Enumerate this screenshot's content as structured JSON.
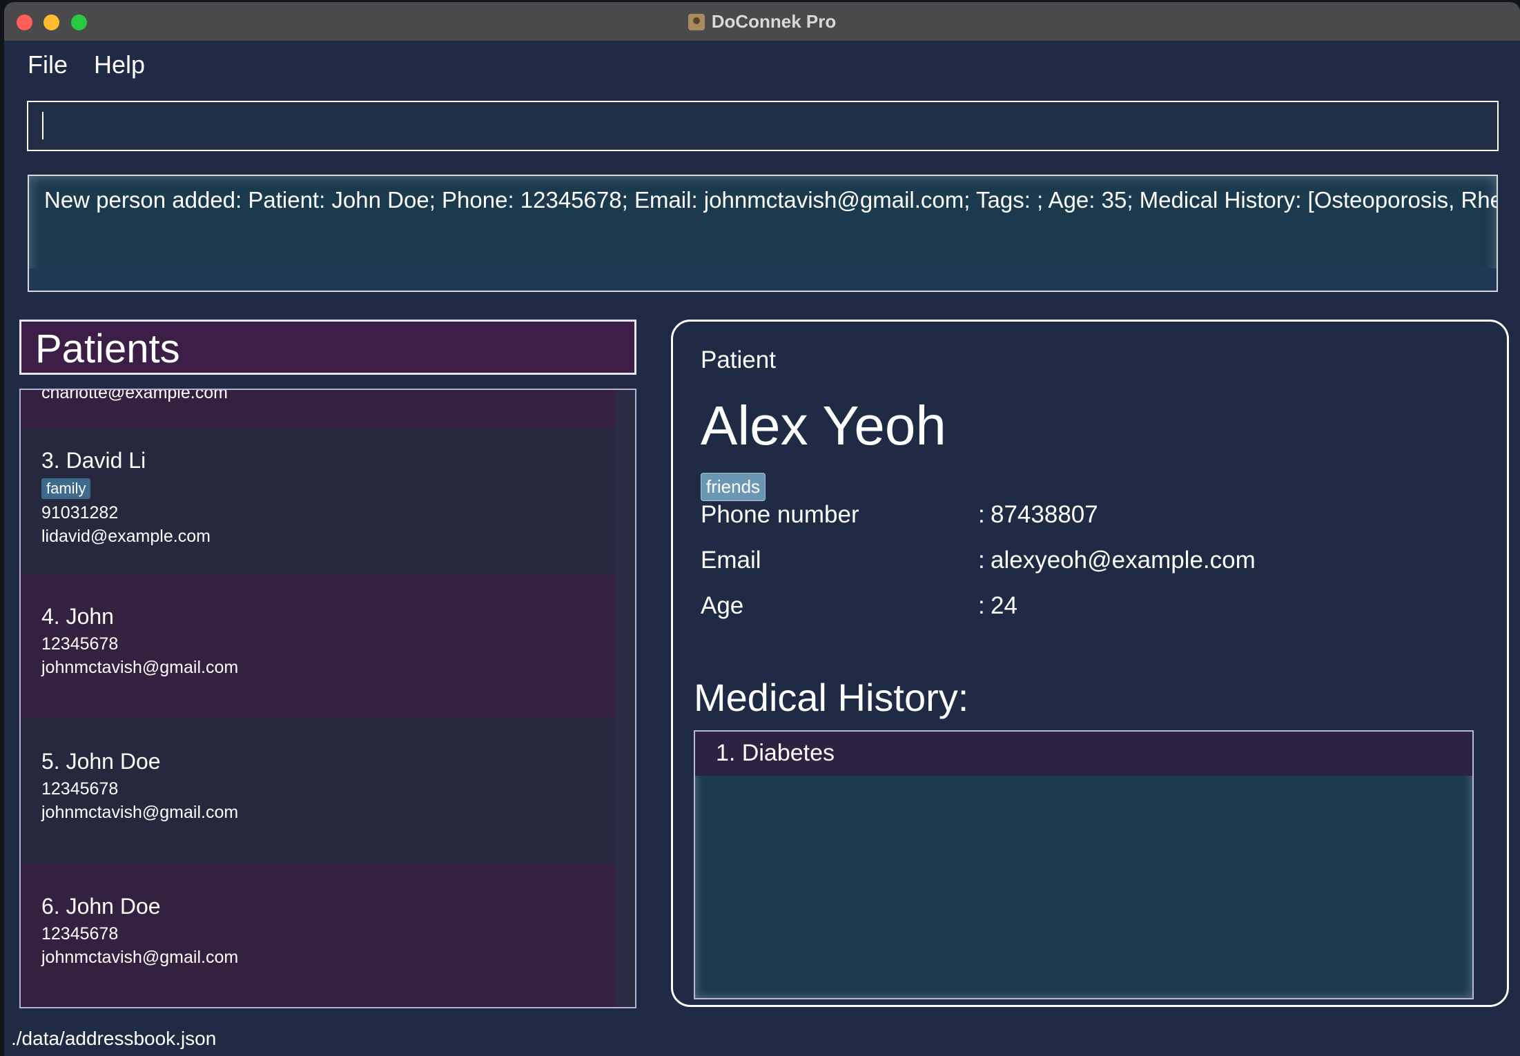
{
  "window": {
    "title": "DoConnek Pro"
  },
  "menu": [
    "File",
    "Help"
  ],
  "command": {
    "value": ""
  },
  "result": {
    "message": "New person added: Patient: John  Doe; Phone: 12345678; Email: johnmctavish@gmail.com; Tags: ; Age: 35; Medical History: [Osteoporosis, Rheu"
  },
  "patients": {
    "header": "Patients",
    "partial_email": "charlotte@example.com",
    "items": [
      {
        "name": "3.  David Li",
        "tag": "family",
        "phone": "91031282",
        "email": "lidavid@example.com"
      },
      {
        "name": "4.  John",
        "phone": "12345678",
        "email": "johnmctavish@gmail.com"
      },
      {
        "name": "5.  John Doe",
        "phone": "12345678",
        "email": "johnmctavish@gmail.com"
      },
      {
        "name": "6.  John  Doe",
        "phone": "12345678",
        "email": "johnmctavish@gmail.com"
      }
    ]
  },
  "detail": {
    "kind": "Patient",
    "name": "Alex Yeoh",
    "tag": "friends",
    "fields": [
      {
        "label": "Phone number",
        "value": "87438807"
      },
      {
        "label": "Email",
        "value": "alexyeoh@example.com"
      },
      {
        "label": "Age",
        "value": "24"
      }
    ],
    "medical_history_heading": "Medical History:",
    "medical_history": [
      "1.  Diabetes"
    ]
  },
  "status": {
    "path": "./data/addressbook.json"
  },
  "colors": {
    "window_bg": "#1f2b44",
    "list_accent": "#3c1e47",
    "tag": "#3e6b8c",
    "detail_tag": "#6b97b5"
  }
}
